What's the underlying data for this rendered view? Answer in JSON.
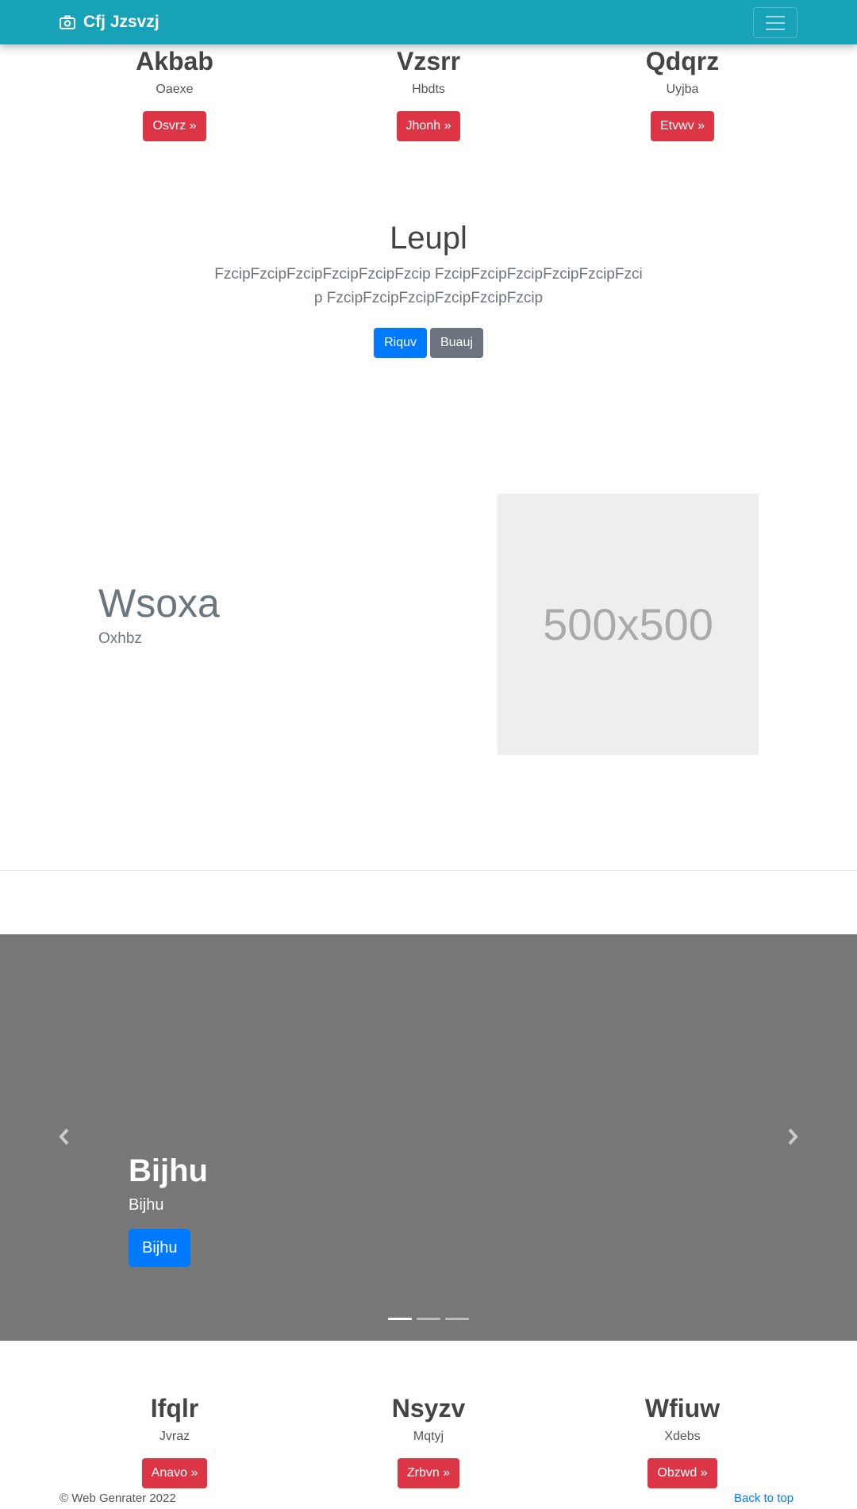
{
  "navbar": {
    "brand": "Cfj Jzsvzj",
    "brand_icon": "camera-icon",
    "toggler_icon": "hamburger-menu-icon"
  },
  "features_top": [
    {
      "title": "Akbab",
      "text": "Oaexe",
      "button": "Osvrz »"
    },
    {
      "title": "Vzsrr",
      "text": "Hbdts",
      "button": "Jhonh »"
    },
    {
      "title": "Qdqrz",
      "text": "Uyjba",
      "button": "Etvwv »"
    }
  ],
  "jumbotron": {
    "title": "Leupl",
    "lead": "FzcipFzcipFzcipFzcipFzcipFzcip FzcipFzcipFzcipFzcipFzcipFzcip FzcipFzcipFzcipFzcipFzcipFzcip",
    "primary_button": "Riquv",
    "secondary_button": "Buauj"
  },
  "featurette": {
    "heading": "Wsoxa",
    "subtext": "Oxhbz",
    "image_label": "500x500"
  },
  "carousel": {
    "caption_title": "Bijhu",
    "caption_text": "Bijhu",
    "caption_button": "Bijhu",
    "prev_icon": "chevron-left-icon",
    "next_icon": "chevron-right-icon",
    "active_slide": 1,
    "slide_count": 3
  },
  "features_bottom": [
    {
      "title": "Ifqlr",
      "text": "Jvraz",
      "button": "Anavo »"
    },
    {
      "title": "Nsyzv",
      "text": "Mqtyj",
      "button": "Zrbvn »"
    },
    {
      "title": "Wfiuw",
      "text": "Xdebs",
      "button": "Obzwd »"
    }
  ],
  "footer": {
    "copyright": "© Web Genrater 2022",
    "back_to_top": "Back to top"
  },
  "colors": {
    "navbar": "#17a2b8",
    "danger": "#dc3545",
    "primary": "#007bff",
    "secondary": "#6c757d",
    "carousel_bg": "#777777"
  }
}
